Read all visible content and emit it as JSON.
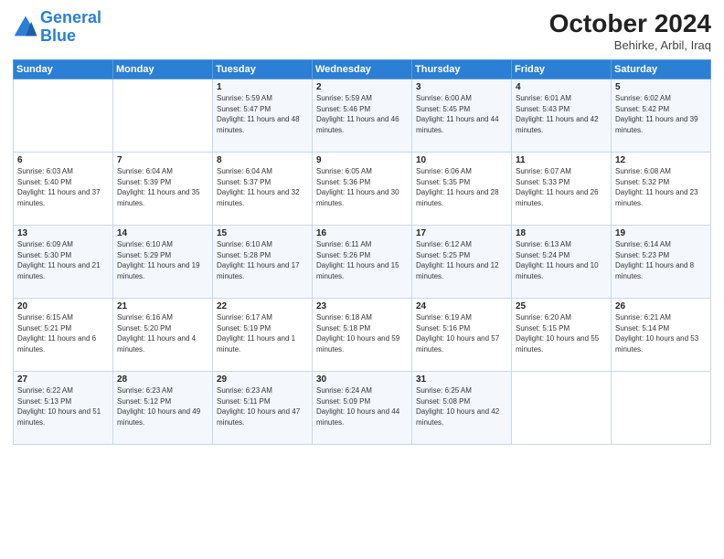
{
  "header": {
    "logo_line1": "General",
    "logo_line2": "Blue",
    "month": "October 2024",
    "location": "Behirke, Arbil, Iraq"
  },
  "weekdays": [
    "Sunday",
    "Monday",
    "Tuesday",
    "Wednesday",
    "Thursday",
    "Friday",
    "Saturday"
  ],
  "weeks": [
    [
      {
        "day": "",
        "text": ""
      },
      {
        "day": "",
        "text": ""
      },
      {
        "day": "1",
        "text": "Sunrise: 5:59 AM\nSunset: 5:47 PM\nDaylight: 11 hours and 48 minutes."
      },
      {
        "day": "2",
        "text": "Sunrise: 5:59 AM\nSunset: 5:46 PM\nDaylight: 11 hours and 46 minutes."
      },
      {
        "day": "3",
        "text": "Sunrise: 6:00 AM\nSunset: 5:45 PM\nDaylight: 11 hours and 44 minutes."
      },
      {
        "day": "4",
        "text": "Sunrise: 6:01 AM\nSunset: 5:43 PM\nDaylight: 11 hours and 42 minutes."
      },
      {
        "day": "5",
        "text": "Sunrise: 6:02 AM\nSunset: 5:42 PM\nDaylight: 11 hours and 39 minutes."
      }
    ],
    [
      {
        "day": "6",
        "text": "Sunrise: 6:03 AM\nSunset: 5:40 PM\nDaylight: 11 hours and 37 minutes."
      },
      {
        "day": "7",
        "text": "Sunrise: 6:04 AM\nSunset: 5:39 PM\nDaylight: 11 hours and 35 minutes."
      },
      {
        "day": "8",
        "text": "Sunrise: 6:04 AM\nSunset: 5:37 PM\nDaylight: 11 hours and 32 minutes."
      },
      {
        "day": "9",
        "text": "Sunrise: 6:05 AM\nSunset: 5:36 PM\nDaylight: 11 hours and 30 minutes."
      },
      {
        "day": "10",
        "text": "Sunrise: 6:06 AM\nSunset: 5:35 PM\nDaylight: 11 hours and 28 minutes."
      },
      {
        "day": "11",
        "text": "Sunrise: 6:07 AM\nSunset: 5:33 PM\nDaylight: 11 hours and 26 minutes."
      },
      {
        "day": "12",
        "text": "Sunrise: 6:08 AM\nSunset: 5:32 PM\nDaylight: 11 hours and 23 minutes."
      }
    ],
    [
      {
        "day": "13",
        "text": "Sunrise: 6:09 AM\nSunset: 5:30 PM\nDaylight: 11 hours and 21 minutes."
      },
      {
        "day": "14",
        "text": "Sunrise: 6:10 AM\nSunset: 5:29 PM\nDaylight: 11 hours and 19 minutes."
      },
      {
        "day": "15",
        "text": "Sunrise: 6:10 AM\nSunset: 5:28 PM\nDaylight: 11 hours and 17 minutes."
      },
      {
        "day": "16",
        "text": "Sunrise: 6:11 AM\nSunset: 5:26 PM\nDaylight: 11 hours and 15 minutes."
      },
      {
        "day": "17",
        "text": "Sunrise: 6:12 AM\nSunset: 5:25 PM\nDaylight: 11 hours and 12 minutes."
      },
      {
        "day": "18",
        "text": "Sunrise: 6:13 AM\nSunset: 5:24 PM\nDaylight: 11 hours and 10 minutes."
      },
      {
        "day": "19",
        "text": "Sunrise: 6:14 AM\nSunset: 5:23 PM\nDaylight: 11 hours and 8 minutes."
      }
    ],
    [
      {
        "day": "20",
        "text": "Sunrise: 6:15 AM\nSunset: 5:21 PM\nDaylight: 11 hours and 6 minutes."
      },
      {
        "day": "21",
        "text": "Sunrise: 6:16 AM\nSunset: 5:20 PM\nDaylight: 11 hours and 4 minutes."
      },
      {
        "day": "22",
        "text": "Sunrise: 6:17 AM\nSunset: 5:19 PM\nDaylight: 11 hours and 1 minute."
      },
      {
        "day": "23",
        "text": "Sunrise: 6:18 AM\nSunset: 5:18 PM\nDaylight: 10 hours and 59 minutes."
      },
      {
        "day": "24",
        "text": "Sunrise: 6:19 AM\nSunset: 5:16 PM\nDaylight: 10 hours and 57 minutes."
      },
      {
        "day": "25",
        "text": "Sunrise: 6:20 AM\nSunset: 5:15 PM\nDaylight: 10 hours and 55 minutes."
      },
      {
        "day": "26",
        "text": "Sunrise: 6:21 AM\nSunset: 5:14 PM\nDaylight: 10 hours and 53 minutes."
      }
    ],
    [
      {
        "day": "27",
        "text": "Sunrise: 6:22 AM\nSunset: 5:13 PM\nDaylight: 10 hours and 51 minutes."
      },
      {
        "day": "28",
        "text": "Sunrise: 6:23 AM\nSunset: 5:12 PM\nDaylight: 10 hours and 49 minutes."
      },
      {
        "day": "29",
        "text": "Sunrise: 6:23 AM\nSunset: 5:11 PM\nDaylight: 10 hours and 47 minutes."
      },
      {
        "day": "30",
        "text": "Sunrise: 6:24 AM\nSunset: 5:09 PM\nDaylight: 10 hours and 44 minutes."
      },
      {
        "day": "31",
        "text": "Sunrise: 6:25 AM\nSunset: 5:08 PM\nDaylight: 10 hours and 42 minutes."
      },
      {
        "day": "",
        "text": ""
      },
      {
        "day": "",
        "text": ""
      }
    ]
  ]
}
